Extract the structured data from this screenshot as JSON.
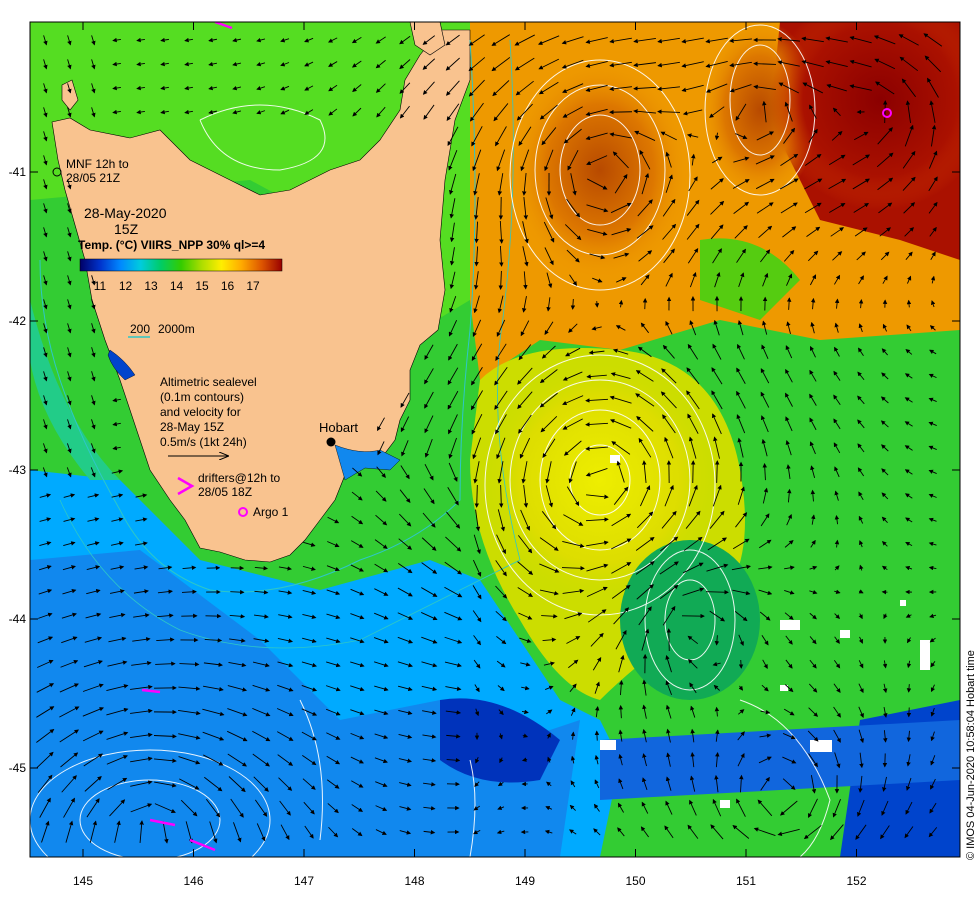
{
  "colors": {
    "land": "#f9c38f",
    "background": "#ffffff",
    "axis": "#000000",
    "contour": "#ffffff",
    "isobath_200": "#2ec7c7",
    "drifter": "#ff00ff",
    "argo": "#ff00ff",
    "colorbar": [
      "#000066",
      "#0022bb",
      "#0066ff",
      "#00aaff",
      "#00d0b0",
      "#00cc44",
      "#66dd00",
      "#ccee00",
      "#ffdd00",
      "#ee9900",
      "#cc5500",
      "#990000"
    ]
  },
  "axes": {
    "x_ticks": [
      "145",
      "146",
      "147",
      "148",
      "149",
      "150",
      "151",
      "152"
    ],
    "y_ticks": [
      "-41",
      "-42",
      "-43",
      "-44",
      "-45"
    ]
  },
  "legend": {
    "mnf_line1": "MNF 12h to",
    "mnf_line2": "28/05 21Z",
    "date_line1": "28-May-2020",
    "date_line2": "15Z",
    "temp_title": "Temp. (°C) VIIRS_NPP 30% ql>=4",
    "colorbar_ticks": [
      "11",
      "12",
      "13",
      "14",
      "15",
      "16",
      "17"
    ],
    "bathy_200": "200",
    "bathy_2000": "2000m",
    "alt_lines": [
      "Altimetric sealevel",
      "(0.1m contours)",
      "and velocity for",
      "28-May 15Z",
      "0.5m/s (1kt 24h)"
    ],
    "drifters_line1": "drifters@12h to",
    "drifters_line2": "28/05 18Z",
    "argo": "Argo 1",
    "hobart": "Hobart"
  },
  "credit": "© IMOS 04-Jun-2020 10:58:04 Hobart time"
}
